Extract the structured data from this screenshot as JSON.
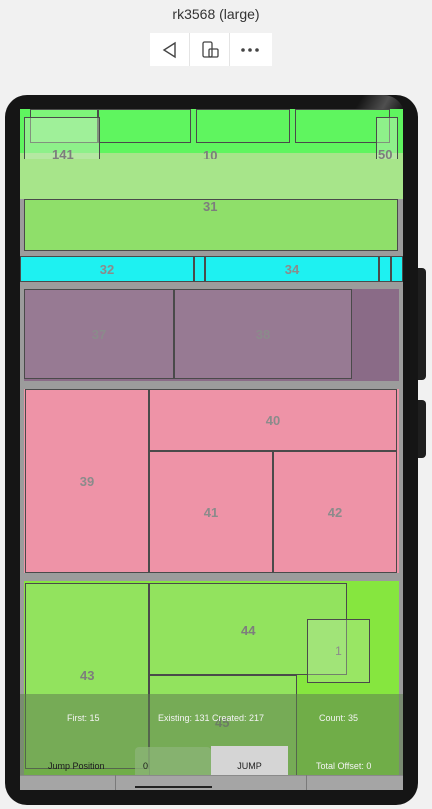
{
  "header": {
    "title": "rk3568 (large)"
  },
  "toolbar": {
    "back_icon": "back-triangle-icon",
    "rotate_icon": "device-rotate-icon",
    "more_icon": "more-dots-icon"
  },
  "colors": {
    "green_bright": "#5ff55f",
    "green_light": "#a7e58a",
    "green_mid": "#8fdf6a",
    "cyan": "#1ef1f1",
    "purple": "#8f6f8a",
    "pink": "#ee93a7",
    "lime": "#8fe35f"
  },
  "grid": {
    "row1": {
      "label_141": "141",
      "label_10": "10",
      "label_50": "50"
    },
    "row2": {
      "label_31": "31"
    },
    "row3": {
      "label_32": "32",
      "label_34": "34"
    },
    "row4": {
      "label_37": "37",
      "label_38": "38"
    },
    "row5": {
      "label_39": "39",
      "label_40": "40",
      "label_41": "41",
      "label_42": "42"
    },
    "row6": {
      "label_43": "43",
      "label_44": "44",
      "label_1": "1",
      "label_45": "45"
    }
  },
  "status": {
    "first": "First: 15",
    "existing": "Existing: 131 Created: 217",
    "count": "Count: 35",
    "jump_position_label": "Jump Position",
    "jump_input_value": "0",
    "jump_button": "JUMP",
    "total_offset": "Total Offset: 0"
  }
}
